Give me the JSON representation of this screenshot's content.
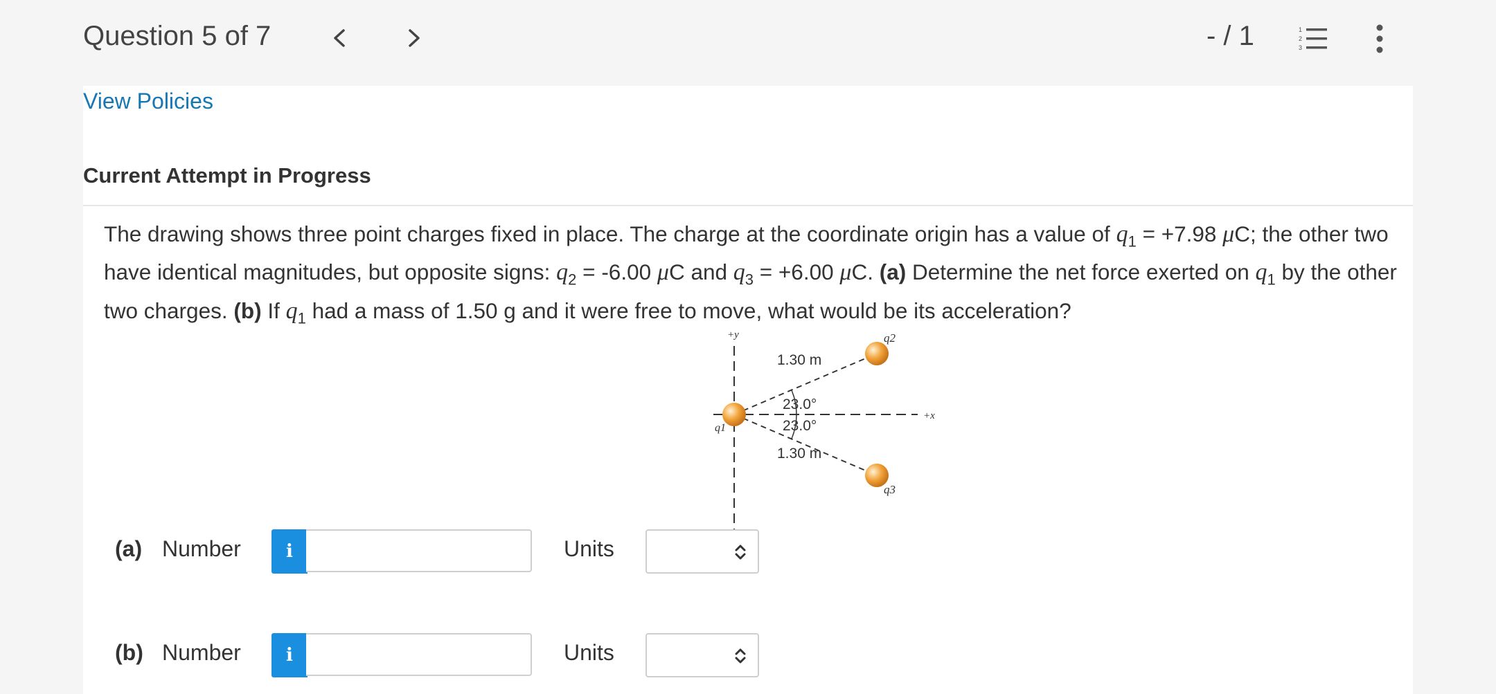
{
  "header": {
    "question_label": "Question 5 of 7",
    "score": "- / 1"
  },
  "links": {
    "view_policies": "View Policies"
  },
  "attempt_heading": "Current Attempt in Progress",
  "problem": {
    "t1": "The drawing shows three point charges fixed in place. The charge at the coordinate origin has a value of ",
    "q1_sym": "q",
    "q1_sub": "1",
    "t2": " = +7.98 ",
    "mu1": "μ",
    "t3": "C; the other two have identical magnitudes, but opposite signs: ",
    "q2_sym": "q",
    "q2_sub": "2",
    "t4": " = -6.00 ",
    "mu2": "μ",
    "t5": "C and ",
    "q3_sym": "q",
    "q3_sub": "3",
    "t6": " = +6.00 ",
    "mu3": "μ",
    "t7": "C. ",
    "part_a": "(a)",
    "t8": " Determine the net force exerted on ",
    "q1b_sym": "q",
    "q1b_sub": "1",
    "t9": " by the other two charges. ",
    "part_b": "(b)",
    "t10": " If ",
    "q1c_sym": "q",
    "q1c_sub": "1",
    "t11": " had a mass of 1.50 g and it were free to move, what would be its acceleration?"
  },
  "diagram": {
    "y_axis_label": "+y",
    "x_axis_label": "+x",
    "q1_label": "q1",
    "q2_label": "q2",
    "q3_label": "q3",
    "dist_top": "1.30 m",
    "dist_bottom": "1.30 m",
    "angle_top": "23.0°",
    "angle_bottom": "23.0°",
    "charge_color": "#f2a43a"
  },
  "answers": [
    {
      "part": "(a)",
      "number_label": "Number",
      "info": "i",
      "value": "",
      "units_label": "Units",
      "units_selected": ""
    },
    {
      "part": "(b)",
      "number_label": "Number",
      "info": "i",
      "value": "",
      "units_label": "Units",
      "units_selected": ""
    }
  ],
  "colors": {
    "accent": "#1a8fe0",
    "link": "#1677b3"
  }
}
